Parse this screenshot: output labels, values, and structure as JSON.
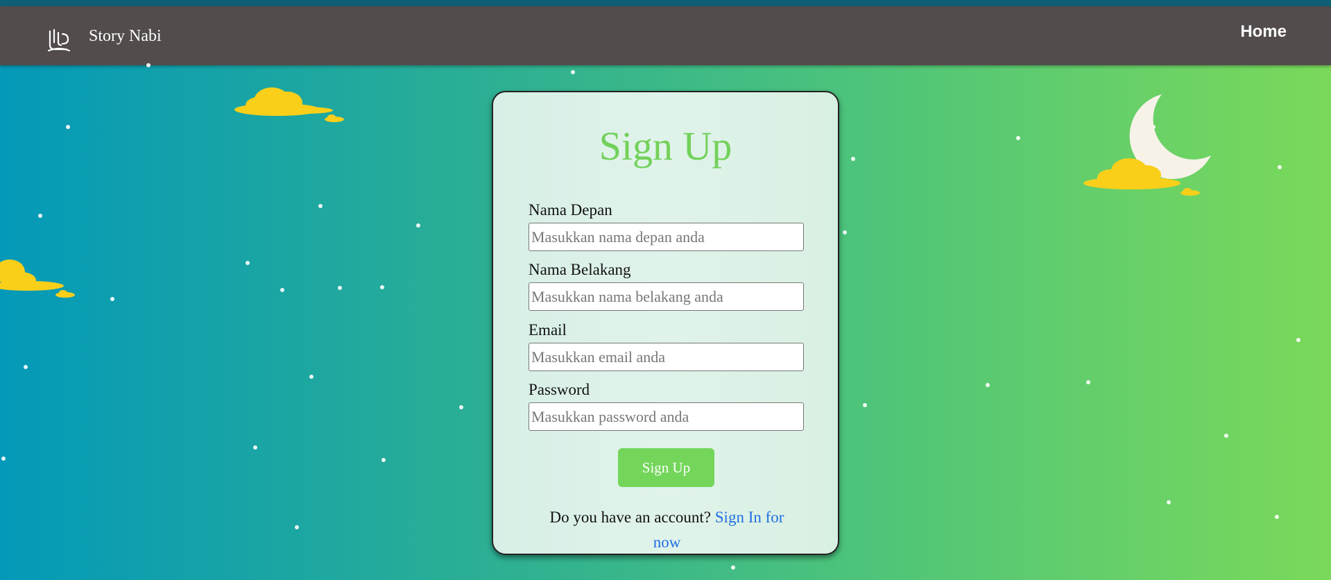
{
  "navbar": {
    "brand_title": "Story Nabi",
    "home_label": "Home",
    "background": "#524c4c"
  },
  "form": {
    "title": "Sign Up",
    "fields": [
      {
        "label": "Nama Depan",
        "placeholder": "Masukkan nama depan anda",
        "value": ""
      },
      {
        "label": "Nama Belakang",
        "placeholder": "Masukkan nama belakang anda",
        "value": ""
      },
      {
        "label": "Email",
        "placeholder": "Masukkan email anda",
        "value": ""
      },
      {
        "label": "Password",
        "placeholder": "Masukkan password anda",
        "value": ""
      }
    ],
    "submit_label": "Sign Up",
    "account_prompt": "Do you have an account? ",
    "account_link": "Sign In for now"
  },
  "colors": {
    "accent": "#73d15a",
    "link": "#1f6fe0",
    "cloud": "#f9cf1a",
    "moon": "#f7f2e8"
  },
  "icons": {
    "brand": "arabic-calligraphy-logo-icon",
    "moon": "crescent-moon-icon",
    "cloud": "cloud-icon"
  }
}
